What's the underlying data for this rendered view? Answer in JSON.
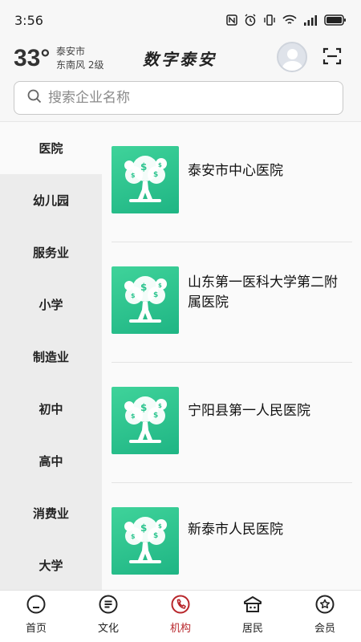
{
  "status_bar": {
    "time": "3:56",
    "icons": [
      "nfc-icon",
      "alarm-icon",
      "vibrate-icon",
      "wifi-icon",
      "signal-icon",
      "battery-icon"
    ]
  },
  "header": {
    "temperature": "33°",
    "city": "泰安市",
    "wind": "东南风  2级",
    "title": "数字泰安"
  },
  "search": {
    "placeholder": "搜索企业名称"
  },
  "categories": [
    {
      "label": "医院",
      "active": true
    },
    {
      "label": "幼儿园"
    },
    {
      "label": "服务业"
    },
    {
      "label": "小学"
    },
    {
      "label": "制造业"
    },
    {
      "label": "初中"
    },
    {
      "label": "高中"
    },
    {
      "label": "消费业"
    },
    {
      "label": "大学"
    }
  ],
  "institutions": [
    {
      "name": "泰安市中心医院"
    },
    {
      "name": "山东第一医科大学第二附属医院"
    },
    {
      "name": "宁阳县第一人民医院"
    },
    {
      "name": "新泰市人民医院"
    }
  ],
  "bottom_nav": [
    {
      "label": "首页",
      "icon": "home-icon"
    },
    {
      "label": "文化",
      "icon": "list-icon"
    },
    {
      "label": "机构",
      "icon": "institution-icon",
      "active": true
    },
    {
      "label": "居民",
      "icon": "resident-icon"
    },
    {
      "label": "会员",
      "icon": "member-star-icon"
    }
  ],
  "colors": {
    "accent": "#b8262b",
    "thumb_green": "#2cc58f"
  }
}
